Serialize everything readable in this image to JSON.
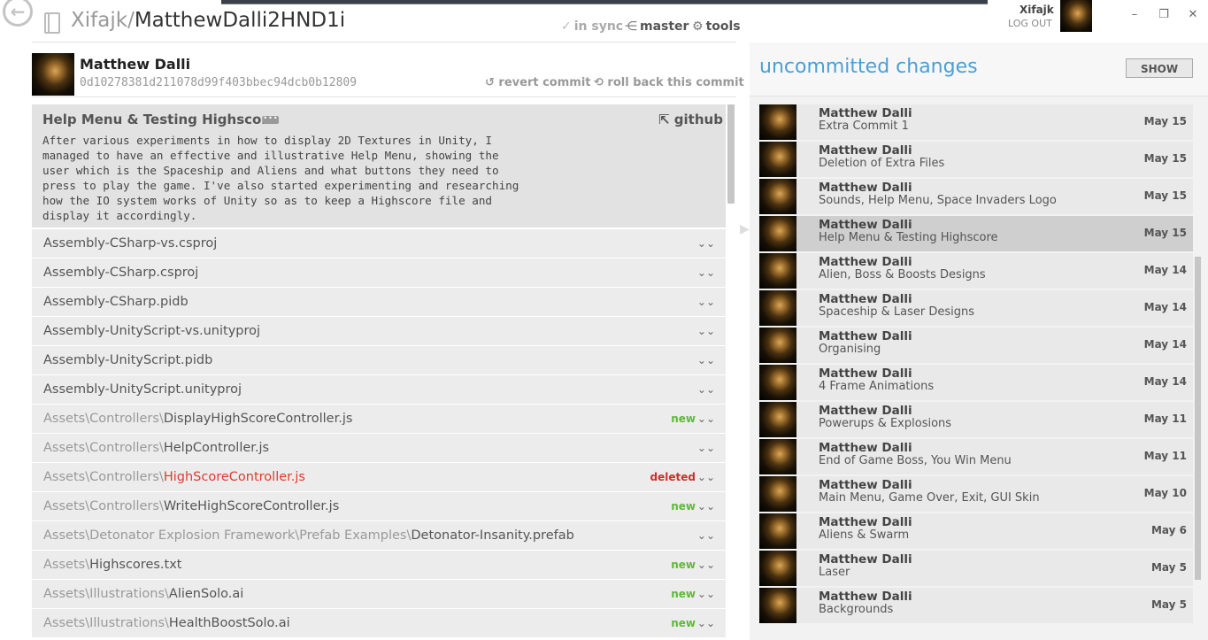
{
  "header": {
    "back_icon": "arrow-left-icon",
    "repo_owner": "Xifajk",
    "repo_sep": "/",
    "repo_name": "MatthewDalli2HND1i",
    "sync_label": "in sync",
    "branch_label": "master",
    "tools_label": "tools",
    "user_name": "Xifajk",
    "logout_label": "LOG OUT",
    "window_buttons": [
      "–",
      "❐",
      "✕"
    ]
  },
  "commit": {
    "author": "Matthew Dalli",
    "hash": "0d10278381d211078d99f403bbec94dcb0b12809",
    "revert_label": "revert commit",
    "rollback_label": "roll back this commit",
    "title": "Help Menu & Testing Highscore",
    "more_label": "•••",
    "github_label": "github",
    "body": "After various experiments in how to display 2D Textures in Unity, I\nmanaged to have an effective and illustrative Help Menu, showing the\nuser which is the Spaceship and Aliens and what buttons they need to\npress to play the game. I've also started experimenting and researching\nhow the IO system works of Unity so as to keep a Highscore file and\ndisplay it accordingly."
  },
  "files": [
    {
      "dir": "",
      "name": "Assembly-CSharp-vs.csproj",
      "status": ""
    },
    {
      "dir": "",
      "name": "Assembly-CSharp.csproj",
      "status": ""
    },
    {
      "dir": "",
      "name": "Assembly-CSharp.pidb",
      "status": ""
    },
    {
      "dir": "",
      "name": "Assembly-UnityScript-vs.unityproj",
      "status": ""
    },
    {
      "dir": "",
      "name": "Assembly-UnityScript.pidb",
      "status": ""
    },
    {
      "dir": "",
      "name": "Assembly-UnityScript.unityproj",
      "status": ""
    },
    {
      "dir": "Assets\\Controllers\\",
      "name": "DisplayHighScoreController.js",
      "status": "new"
    },
    {
      "dir": "Assets\\Controllers\\",
      "name": "HelpController.js",
      "status": ""
    },
    {
      "dir": "Assets\\Controllers\\",
      "name": "HighScoreController.js",
      "status": "deleted"
    },
    {
      "dir": "Assets\\Controllers\\",
      "name": "WriteHighScoreController.js",
      "status": "new"
    },
    {
      "dir": "Assets\\Detonator Explosion Framework\\Prefab Examples\\",
      "name": "Detonator-Insanity.prefab",
      "status": ""
    },
    {
      "dir": "Assets\\",
      "name": "Highscores.txt",
      "status": "new"
    },
    {
      "dir": "Assets\\Illustrations\\",
      "name": "AlienSolo.ai",
      "status": "new"
    },
    {
      "dir": "Assets\\Illustrations\\",
      "name": "HealthBoostSolo.ai",
      "status": "new"
    }
  ],
  "uncommitted": {
    "title": "uncommitted changes",
    "show_label": "SHOW"
  },
  "history": [
    {
      "author": "Matthew Dalli",
      "message": "Extra Commit 1",
      "date": "May 15",
      "selected": false
    },
    {
      "author": "Matthew Dalli",
      "message": "Deletion of Extra Files",
      "date": "May 15",
      "selected": false
    },
    {
      "author": "Matthew Dalli",
      "message": "Sounds, Help Menu, Space Invaders Logo",
      "date": "May 15",
      "selected": false
    },
    {
      "author": "Matthew Dalli",
      "message": "Help Menu & Testing Highscore",
      "date": "May 15",
      "selected": true
    },
    {
      "author": "Matthew Dalli",
      "message": "Alien, Boss & Boosts Designs",
      "date": "May 14",
      "selected": false
    },
    {
      "author": "Matthew Dalli",
      "message": "Spaceship & Laser Designs",
      "date": "May 14",
      "selected": false
    },
    {
      "author": "Matthew Dalli",
      "message": "Organising",
      "date": "May 14",
      "selected": false
    },
    {
      "author": "Matthew Dalli",
      "message": "4 Frame Animations",
      "date": "May 14",
      "selected": false
    },
    {
      "author": "Matthew Dalli",
      "message": "Powerups & Explosions",
      "date": "May 11",
      "selected": false
    },
    {
      "author": "Matthew Dalli",
      "message": "End of Game Boss, You Win Menu",
      "date": "May 11",
      "selected": false
    },
    {
      "author": "Matthew Dalli",
      "message": "Main Menu, Game Over, Exit, GUI Skin",
      "date": "May 10",
      "selected": false
    },
    {
      "author": "Matthew Dalli",
      "message": "Aliens & Swarm",
      "date": "May 6",
      "selected": false
    },
    {
      "author": "Matthew Dalli",
      "message": "Laser",
      "date": "May 5",
      "selected": false
    },
    {
      "author": "Matthew Dalli",
      "message": "Backgrounds",
      "date": "May 5",
      "selected": false
    }
  ]
}
